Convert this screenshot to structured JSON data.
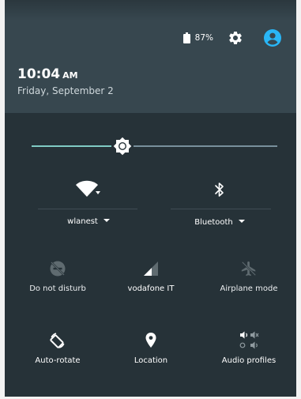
{
  "status": {
    "battery_percent": "87%",
    "icons": [
      "battery-icon",
      "gear-icon",
      "account-icon"
    ]
  },
  "clock": {
    "time": "10:04",
    "ampm": "AM",
    "date": "Friday, September 2"
  },
  "brightness": {
    "level": 0.37
  },
  "colors": {
    "accent": "#80cbc4",
    "account": "#29b6f6",
    "header_bg": "#37474f",
    "panel_bg": "#263238"
  },
  "tiles": {
    "wifi": {
      "label": "wlanest",
      "icon": "wifi-icon"
    },
    "bluetooth": {
      "label": "Bluetooth",
      "icon": "bluetooth-icon"
    },
    "dnd": {
      "label": "Do not disturb",
      "icon": "do-not-disturb-off-icon"
    },
    "cellular": {
      "label": "vodafone IT",
      "icon": "cellular-signal-icon"
    },
    "airplane": {
      "label": "Airplane mode",
      "icon": "airplane-mode-off-icon"
    },
    "rotate": {
      "label": "Auto-rotate",
      "icon": "screen-rotation-icon"
    },
    "location": {
      "label": "Location",
      "icon": "location-pin-icon"
    },
    "audio": {
      "label": "Audio profiles",
      "icon": "audio-profiles-icon"
    }
  }
}
